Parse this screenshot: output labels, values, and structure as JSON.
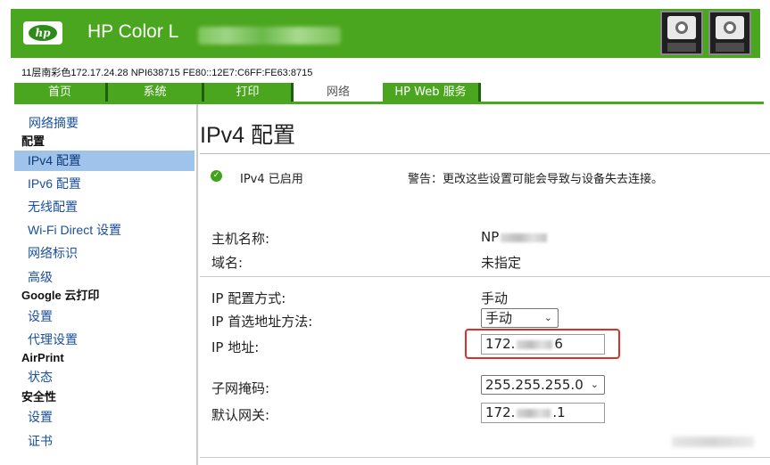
{
  "header": {
    "title_prefix": "HP Color L",
    "logo_text": "hp"
  },
  "info_line": "11层南彩色172.17.24.28  NPI638715  FE80::12E7:C6FF:FE63:8715",
  "tabs": [
    {
      "label": "首页",
      "active": false
    },
    {
      "label": "系统",
      "active": false
    },
    {
      "label": "打印",
      "active": false
    },
    {
      "label": "网络",
      "active": true
    },
    {
      "label": "HP Web 服务",
      "active": false
    }
  ],
  "sidebar": {
    "summary": "网络摘要",
    "config_head": "配置",
    "ipv4": "IPv4 配置",
    "ipv6": "IPv6 配置",
    "wireless": "无线配置",
    "wifi_direct": "Wi-Fi Direct 设置",
    "network_id": "网络标识",
    "advanced": "高级",
    "google_head": "Google 云打印",
    "google_settings": "设置",
    "proxy": "代理设置",
    "airprint_head": "AirPrint",
    "airprint_status": "状态",
    "security_head": "安全性",
    "security_settings": "设置",
    "certificates": "证书"
  },
  "main": {
    "page_title": "IPv4 配置",
    "status": "IPv4 已启用",
    "warning": "警告：更改这些设置可能会导致与设备失去连接。",
    "hostname_label": "主机名称:",
    "hostname_value_prefix": "NP",
    "domain_label": "域名:",
    "domain_value": "未指定",
    "ip_method_label": "IP 配置方式:",
    "ip_method_value": "手动",
    "ip_pref_label": "IP 首选地址方法:",
    "ip_pref_value": "手动",
    "ip_addr_label": "IP 地址:",
    "ip_addr_prefix": "172.",
    "ip_addr_suffix": "6",
    "subnet_label": "子网掩码:",
    "subnet_value": "255.255.255.0",
    "gateway_label": "默认网关:",
    "gateway_prefix": "172.",
    "gateway_suffix": ".1"
  },
  "colors": {
    "brand_green": "#4aa61e",
    "selected_nav": "#9fc3ea",
    "highlight_red": "#d9302c"
  }
}
